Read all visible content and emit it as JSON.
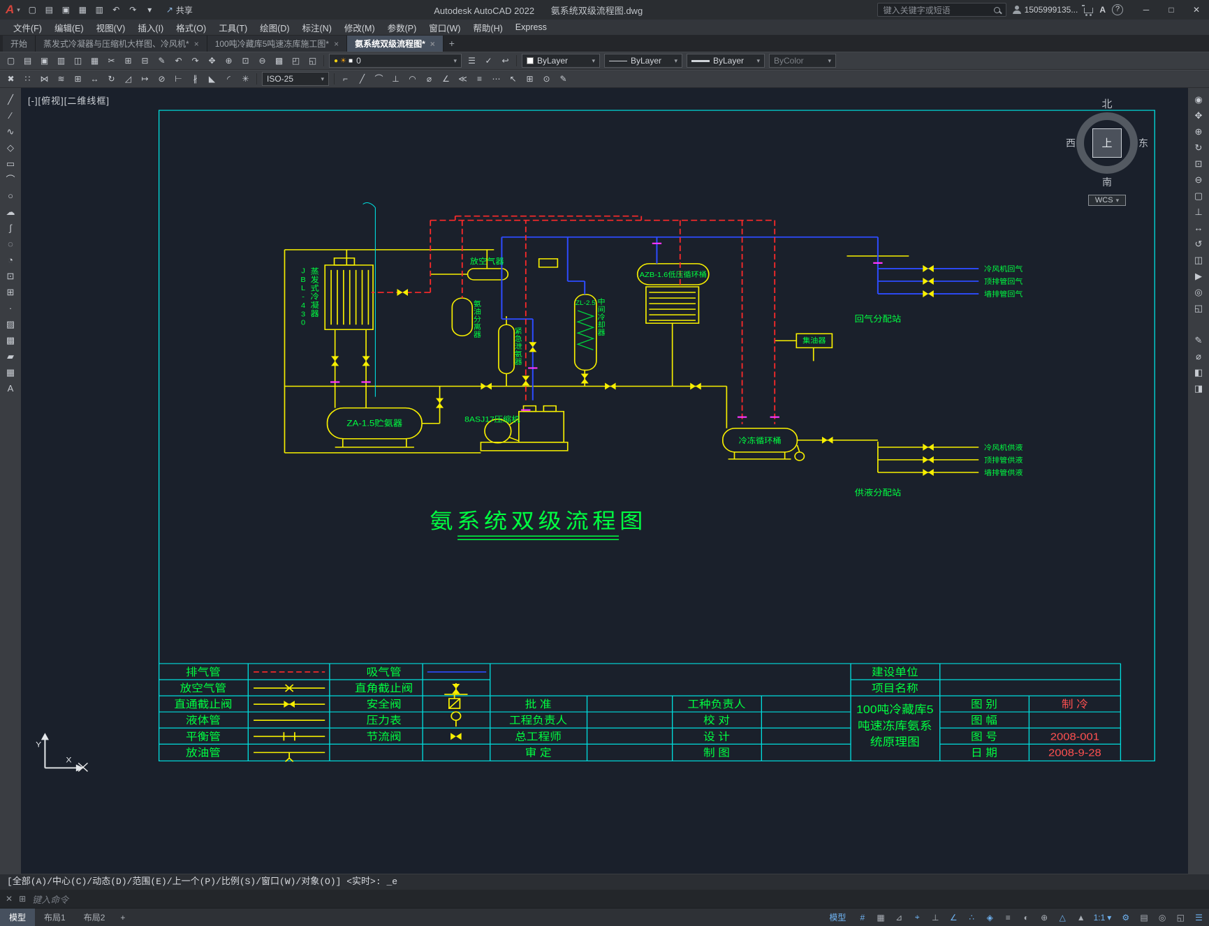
{
  "colors": {
    "canvas_bg": "#1a202b",
    "frame_cyan": "#00dcdc",
    "pipe_yellow": "#f7ef00",
    "pipe_red": "#ff2a2a",
    "pipe_blue": "#2d4bff",
    "label_green": "#00ff41",
    "valve_magenta": "#ff35ff",
    "value_red": "#ff5050",
    "accent_blue": "#6fb3f2"
  },
  "ui": {
    "dropdown_arrow": "▾",
    "window_min": "─",
    "window_max": "□",
    "window_close": "✕",
    "share_icon": "↗"
  },
  "titlebar": {
    "logo": "A",
    "app_title": "Autodesk AutoCAD 2022",
    "doc_title": "氨系统双级流程图.dwg",
    "share": "共享",
    "search_placeholder": "键入关键字或短语",
    "user_id": "1505999135...",
    "autodesk": "A",
    "help": "?",
    "quick_access": [
      {
        "name": "new-file-icon",
        "glyph": "▢"
      },
      {
        "name": "open-folder-icon",
        "glyph": "▤"
      },
      {
        "name": "save-icon",
        "glyph": "▣"
      },
      {
        "name": "save-as-icon",
        "glyph": "▦"
      },
      {
        "name": "plot-icon",
        "glyph": "▥"
      },
      {
        "name": "undo-icon",
        "glyph": "↶"
      },
      {
        "name": "redo-icon",
        "glyph": "↷"
      },
      {
        "name": "quick-access-dropdown-icon",
        "glyph": "▾"
      }
    ]
  },
  "menubar": {
    "items": [
      {
        "name": "menu-file",
        "label": "文件(F)"
      },
      {
        "name": "menu-edit",
        "label": "编辑(E)"
      },
      {
        "name": "menu-view",
        "label": "视图(V)"
      },
      {
        "name": "menu-insert",
        "label": "插入(I)"
      },
      {
        "name": "menu-format",
        "label": "格式(O)"
      },
      {
        "name": "menu-tools",
        "label": "工具(T)"
      },
      {
        "name": "menu-draw",
        "label": "绘图(D)"
      },
      {
        "name": "menu-dimension",
        "label": "标注(N)"
      },
      {
        "name": "menu-modify",
        "label": "修改(M)"
      },
      {
        "name": "menu-parametric",
        "label": "参数(P)"
      },
      {
        "name": "menu-window",
        "label": "窗口(W)"
      },
      {
        "name": "menu-help",
        "label": "帮助(H)"
      },
      {
        "name": "menu-express",
        "label": "Express"
      }
    ]
  },
  "filetabs": {
    "start_tab": "开始",
    "tabs": [
      {
        "label": "蒸发式冷凝器与压缩机大样图、冷风机*",
        "close": "×"
      },
      {
        "label": "100吨冷藏库5吨速冻库施工图*",
        "close": "×"
      },
      {
        "label": "氨系统双级流程图*",
        "close": "×"
      }
    ],
    "new_tab": "+"
  },
  "toolbars": {
    "row1": [
      {
        "name": "qnew-icon",
        "glyph": "▢"
      },
      {
        "name": "open-icon",
        "glyph": "▤"
      },
      {
        "name": "qsave-icon",
        "glyph": "▣"
      },
      {
        "name": "plot-icon",
        "glyph": "▥"
      },
      {
        "name": "plot-preview-icon",
        "glyph": "◫"
      },
      {
        "name": "publish-icon",
        "glyph": "▦"
      },
      {
        "name": "cut-icon",
        "glyph": "✂"
      },
      {
        "name": "copy-clip-icon",
        "glyph": "⊞"
      },
      {
        "name": "paste-icon",
        "glyph": "⊟"
      },
      {
        "name": "match-properties-icon",
        "glyph": "✎"
      },
      {
        "name": "undo-icon",
        "glyph": "↶"
      },
      {
        "name": "redo-icon",
        "glyph": "↷"
      },
      {
        "name": "pan-realtime-icon",
        "glyph": "✥"
      },
      {
        "name": "zoom-realtime-icon",
        "glyph": "⊕"
      },
      {
        "name": "zoom-window-icon",
        "glyph": "⊡"
      },
      {
        "name": "zoom-previous-icon",
        "glyph": "⊖"
      },
      {
        "name": "properties-palette-icon",
        "glyph": "▩"
      },
      {
        "name": "designcenter-icon",
        "glyph": "◰"
      },
      {
        "name": "tool-palettes-icon",
        "glyph": "◱"
      }
    ],
    "layer_status_icons": [
      {
        "name": "layer-on-icon",
        "glyph": "●",
        "cls": "c-yellow"
      },
      {
        "name": "layer-thaw-icon",
        "glyph": "☀",
        "cls": "c-orange"
      },
      {
        "name": "layer-color-swatch",
        "glyph": "■",
        "cls": "c-white"
      }
    ],
    "layer_value": "0",
    "layer_tools": [
      {
        "name": "layer-properties-icon",
        "glyph": "☰"
      },
      {
        "name": "make-current-layer-icon",
        "glyph": "✓"
      },
      {
        "name": "layer-previous-icon",
        "glyph": "↩"
      }
    ],
    "color_value": "ByLayer",
    "linetype_value": "ByLayer",
    "lineweight_value": "ByLayer",
    "plotstyle_value": "ByColor",
    "dimstyle_value": "ISO-25",
    "row2a": [
      {
        "name": "erase-icon",
        "glyph": "✖"
      },
      {
        "name": "copy-object-icon",
        "glyph": "∷"
      },
      {
        "name": "mirror-icon",
        "glyph": "⋈"
      },
      {
        "name": "offset-icon",
        "glyph": "≋"
      },
      {
        "name": "array-icon",
        "glyph": "⊞"
      },
      {
        "name": "move-icon",
        "glyph": "↔"
      },
      {
        "name": "rotate-icon",
        "glyph": "↻"
      },
      {
        "name": "scale-icon",
        "glyph": "◿"
      },
      {
        "name": "stretch-icon",
        "glyph": "↦"
      },
      {
        "name": "trim-icon",
        "glyph": "⊘"
      },
      {
        "name": "extend-icon",
        "glyph": "⊢"
      },
      {
        "name": "break-icon",
        "glyph": "∦"
      },
      {
        "name": "chamfer-icon",
        "glyph": "◣"
      },
      {
        "name": "fillet-icon",
        "glyph": "◜"
      },
      {
        "name": "explode-icon",
        "glyph": "✳"
      }
    ],
    "row2b": [
      {
        "name": "dim-linear-icon",
        "glyph": "⌐"
      },
      {
        "name": "dim-aligned-icon",
        "glyph": "╱"
      },
      {
        "name": "dim-arc-icon",
        "glyph": "⌒"
      },
      {
        "name": "dim-ordinate-icon",
        "glyph": "⊥"
      },
      {
        "name": "dim-radius-icon",
        "glyph": "◠"
      },
      {
        "name": "dim-diameter-icon",
        "glyph": "⌀"
      },
      {
        "name": "dim-angular-icon",
        "glyph": "∠"
      },
      {
        "name": "quick-dim-icon",
        "glyph": "≪"
      },
      {
        "name": "dim-baseline-icon",
        "glyph": "≡"
      },
      {
        "name": "dim-continue-icon",
        "glyph": "⋯"
      },
      {
        "name": "multileader-icon",
        "glyph": "↖"
      },
      {
        "name": "tolerance-icon",
        "glyph": "⊞"
      },
      {
        "name": "center-mark-icon",
        "glyph": "⊙"
      },
      {
        "name": "dim-edit-icon",
        "glyph": "✎"
      }
    ]
  },
  "side_toolbars": {
    "left": [
      {
        "name": "line-tool-icon",
        "glyph": "╱"
      },
      {
        "name": "construction-line-icon",
        "glyph": "∕"
      },
      {
        "name": "polyline-icon",
        "glyph": "∿"
      },
      {
        "name": "polygon-icon",
        "glyph": "◇"
      },
      {
        "name": "rectangle-icon",
        "glyph": "▭"
      },
      {
        "name": "arc-icon",
        "glyph": "⌒"
      },
      {
        "name": "circle-icon",
        "glyph": "○"
      },
      {
        "name": "revision-cloud-icon",
        "glyph": "☁"
      },
      {
        "name": "spline-icon",
        "glyph": "∫"
      },
      {
        "name": "ellipse-icon",
        "glyph": "◌"
      },
      {
        "name": "ellipse-arc-icon",
        "glyph": "◔"
      },
      {
        "name": "insert-block-icon",
        "glyph": "⊡"
      },
      {
        "name": "make-block-icon",
        "glyph": "⊞"
      },
      {
        "name": "point-icon",
        "glyph": "·"
      },
      {
        "name": "hatch-icon",
        "glyph": "▨"
      },
      {
        "name": "gradient-icon",
        "glyph": "▩"
      },
      {
        "name": "region-icon",
        "glyph": "▰"
      },
      {
        "name": "table-icon",
        "glyph": "▦"
      },
      {
        "name": "mtext-icon",
        "glyph": "A"
      }
    ],
    "right": [
      {
        "name": "navigation-wheel-icon",
        "glyph": "◉"
      },
      {
        "name": "pan-icon",
        "glyph": "✥"
      },
      {
        "name": "zoom-extents-icon",
        "glyph": "⊕"
      },
      {
        "name": "orbit-icon",
        "glyph": "↻"
      },
      {
        "name": "zoom-window-icon",
        "glyph": "⊡"
      },
      {
        "name": "zoom-previous-icon",
        "glyph": "⊖"
      },
      {
        "name": "named-views-icon",
        "glyph": "▢"
      },
      {
        "name": "ucs-tool-icon",
        "glyph": "⊥"
      },
      {
        "name": "move-view-icon",
        "glyph": "↔"
      },
      {
        "name": "rotate-view-icon",
        "glyph": "↺"
      },
      {
        "name": "viewport-icon",
        "glyph": "◫"
      },
      {
        "name": "show-motion-icon",
        "glyph": "▶"
      },
      {
        "name": "steering-icon",
        "glyph": "◎"
      },
      {
        "name": "fullscreen-icon",
        "glyph": "◱"
      }
    ],
    "right2": [
      {
        "name": "annotate-tool-icon",
        "glyph": "✎"
      },
      {
        "name": "measure-tool-icon",
        "glyph": "⌀"
      },
      {
        "name": "section-tool-icon",
        "glyph": "◧"
      },
      {
        "name": "camera-tool-icon",
        "glyph": "◨"
      }
    ]
  },
  "drawing": {
    "viewport_label": "[-][俯视][二维线框]",
    "title": "氨系统双级流程图",
    "equipment": {
      "condenser_model": "JBL-430",
      "condenser": "蒸发式冷凝器",
      "air_purger": "放空气器",
      "oil_separator": "氨油分离器",
      "intercooler_model": "ZL-2.5",
      "intercooler": "中间冷却器",
      "emergency_vessel": "紧急泄氨器",
      "lp_drum": "AZB-1.6低压循环桶",
      "receiver": "ZA-1.5贮氨器",
      "compressor": "8ASJ17压缩机",
      "lt_drum": "冷冻循环桶",
      "oil_collector": "集油器",
      "suction_manifold": "回气分配站",
      "liquid_manifold": "供液分配站"
    },
    "suction_branches": [
      "冷风机回气",
      "顶排管回气",
      "墙排管回气"
    ],
    "liquid_branches": [
      "冷风机供液",
      "顶排管供液",
      "墙排管供液"
    ],
    "viewcube": {
      "north": "北",
      "south": "南",
      "east": "东",
      "west": "西",
      "top": "上",
      "wcs": "WCS"
    },
    "ucs": {
      "x": "X",
      "y": "Y"
    }
  },
  "legend": {
    "rows": [
      {
        "l": "排气管",
        "r": "吸气管"
      },
      {
        "l": "放空气管",
        "r": "直角截止阀"
      },
      {
        "l": "直通截止阀",
        "r": "安全阀"
      },
      {
        "l": "液体管",
        "r": "压力表"
      },
      {
        "l": "平衡管",
        "r": "节流阀"
      },
      {
        "l": "放油管",
        "r": ""
      }
    ]
  },
  "titleblock": {
    "owner_label": "建设单位",
    "project_label": "项目名称",
    "sign_rows": [
      {
        "l": "批 准",
        "r": "工种负责人"
      },
      {
        "l": "工程负责人",
        "r": "校 对"
      },
      {
        "l": "总工程师",
        "r": "设 计"
      },
      {
        "l": "审 定",
        "r": "制 图"
      }
    ],
    "drawing_name_lines": [
      "100吨冷藏库5",
      "吨速冻库氨系",
      "统原理图"
    ],
    "info_rows": [
      {
        "label": "图 别",
        "value": "制 冷"
      },
      {
        "label": "图 幅",
        "value": ""
      },
      {
        "label": "图 号",
        "value": "2008-001"
      },
      {
        "label": "日 期",
        "value": "2008-9-28"
      }
    ]
  },
  "cmdline": {
    "history": "[全部(A)/中心(C)/动态(D)/范围(E)/上一个(P)/比例(S)/窗口(W)/对象(O)] <实时>: _e",
    "close_icon": "✕",
    "customize_icon": "⊞",
    "prompt": "键入命令"
  },
  "statusbar": {
    "tabs": [
      {
        "name": "model-tab",
        "label": "模型",
        "cls": "active"
      },
      {
        "name": "layout1-tab",
        "label": "布局1",
        "cls": ""
      },
      {
        "name": "layout2-tab",
        "label": "布局2",
        "cls": ""
      },
      {
        "name": "new-layout-tab",
        "label": "+",
        "cls": "plus"
      }
    ],
    "right": [
      {
        "name": "model-paper-toggle",
        "label": "模型",
        "glyph": "",
        "cls": "on"
      },
      {
        "name": "grid-icon",
        "label": "",
        "glyph": "#",
        "cls": "on"
      },
      {
        "name": "snap-mode-icon",
        "label": "",
        "glyph": "▦",
        "cls": ""
      },
      {
        "name": "infer-constraints-icon",
        "label": "",
        "glyph": "⊿",
        "cls": ""
      },
      {
        "name": "dynamic-input-icon",
        "label": "",
        "glyph": "⌖",
        "cls": "on"
      },
      {
        "name": "ortho-icon",
        "label": "",
        "glyph": "⊥",
        "cls": ""
      },
      {
        "name": "polar-tracking-icon",
        "label": "",
        "glyph": "∠",
        "cls": "on"
      },
      {
        "name": "osnap-tracking-icon",
        "label": "",
        "glyph": "∴",
        "cls": "on"
      },
      {
        "name": "osnap-icon",
        "label": "",
        "glyph": "◈",
        "cls": "on"
      },
      {
        "name": "lineweight-icon",
        "label": "",
        "glyph": "≡",
        "cls": ""
      },
      {
        "name": "transparency-icon",
        "label": "",
        "glyph": "◐",
        "cls": ""
      },
      {
        "name": "selection-cycling-icon",
        "label": "",
        "glyph": "⊕",
        "cls": ""
      },
      {
        "name": "annotation-visibility-icon",
        "label": "",
        "glyph": "△",
        "cls": "on"
      },
      {
        "name": "annotation-autoscale-icon",
        "label": "",
        "glyph": "▲",
        "cls": ""
      },
      {
        "name": "annotation-scale-button",
        "label": "1:1",
        "glyph": "▾",
        "cls": "on"
      },
      {
        "name": "workspace-switch-icon",
        "label": "",
        "glyph": "⚙",
        "cls": "on"
      },
      {
        "name": "quick-properties-icon",
        "label": "",
        "glyph": "▤",
        "cls": ""
      },
      {
        "name": "isolate-objects-icon",
        "label": "",
        "glyph": "◎",
        "cls": ""
      },
      {
        "name": "clean-screen-icon",
        "label": "",
        "glyph": "◱",
        "cls": ""
      },
      {
        "name": "customize-menu-icon",
        "label": "",
        "glyph": "☰",
        "cls": "on"
      }
    ]
  }
}
